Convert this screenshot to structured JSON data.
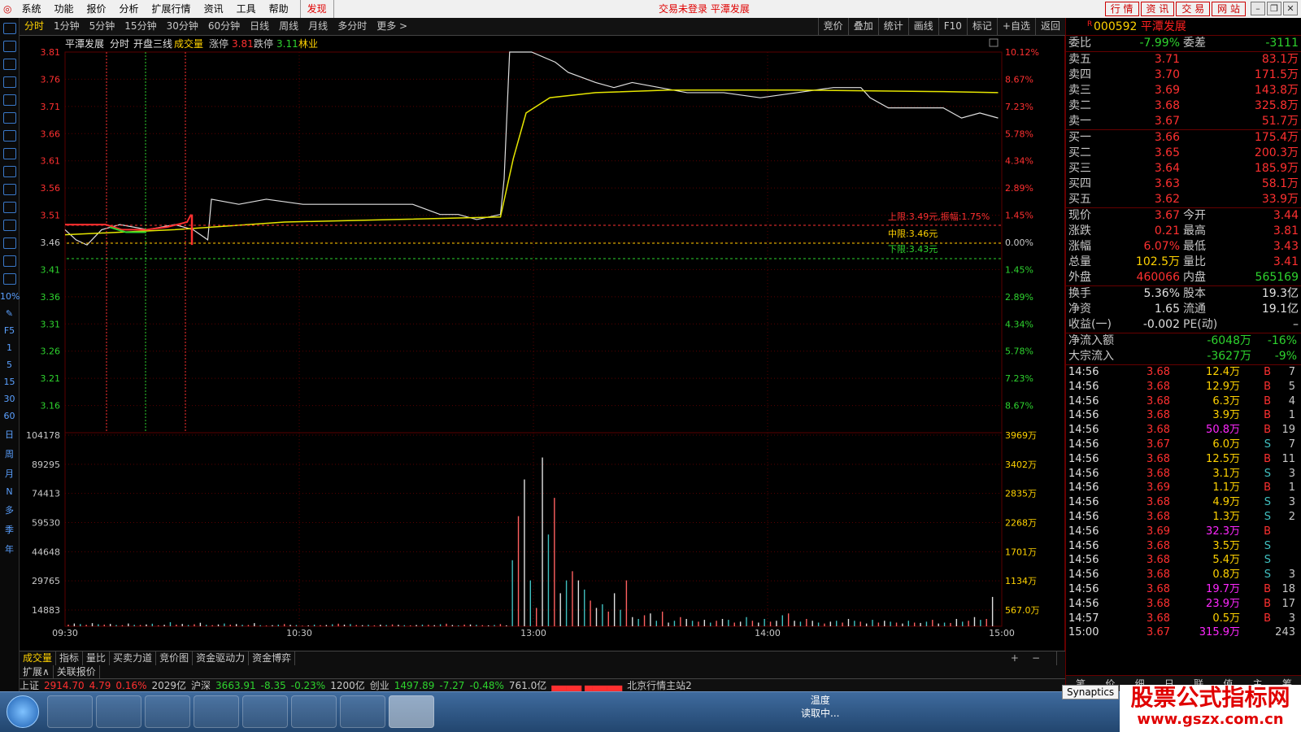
{
  "menubar": {
    "items": [
      "系统",
      "功能",
      "报价",
      "分析",
      "扩展行情",
      "资讯",
      "工具",
      "帮助"
    ],
    "highlight": "发现",
    "status": "交易未登录  平潭发展",
    "right_buttons": [
      "行  情",
      "资  讯",
      "交  易",
      "网  站"
    ]
  },
  "timeframes": {
    "items": [
      "分时",
      "1分钟",
      "5分钟",
      "15分钟",
      "30分钟",
      "60分钟",
      "日线",
      "周线",
      "月线",
      "多分时",
      "更多 >"
    ],
    "active_index": 0,
    "right_tools": [
      "竞价",
      "叠加",
      "统计",
      "画线",
      "F10",
      "标记",
      "+自选",
      "返回"
    ]
  },
  "chart_header": {
    "name": "平潭发展",
    "type": "分时",
    "overlay": "开盘三线",
    "indicator": "成交量",
    "zt_label": "涨停",
    "zt_value": "3.81",
    "dt_label": "跌停",
    "dt_value": "3.11",
    "sector": "林业"
  },
  "price_annotations": {
    "upper": "上限:3.49元,振幅:1.75%",
    "middle": "中限:3.46元",
    "lower": "下限:3.43元"
  },
  "left_toolbar_labels": [
    "10%",
    "F5",
    "1",
    "5",
    "15",
    "30",
    "60",
    "日",
    "周",
    "月",
    "N",
    "多",
    "季",
    "年"
  ],
  "chart_data": [
    {
      "type": "line",
      "title": "平潭发展 分时",
      "prev_close": 3.46,
      "ylim": [
        3.11,
        3.81
      ],
      "y_ticks": [
        "3.81",
        "3.76",
        "3.71",
        "3.66",
        "3.61",
        "3.56",
        "3.51",
        "3.46",
        "3.41",
        "3.36",
        "3.31",
        "3.26",
        "3.21",
        "3.16"
      ],
      "y_right_ticks": [
        "10.12%",
        "8.67%",
        "7.23%",
        "5.78%",
        "4.34%",
        "2.89%",
        "1.45%",
        "0.00%",
        "1.45%",
        "2.89%",
        "4.34%",
        "5.78%",
        "7.23%",
        "8.67%"
      ],
      "x_ticks": [
        "09:30",
        "10:30",
        "13:00",
        "14:00",
        "15:00"
      ],
      "series": [
        {
          "name": "价格",
          "color": "#e0e0e0",
          "points": [
            [
              0,
              3.46
            ],
            [
              6,
              3.44
            ],
            [
              12,
              3.43
            ],
            [
              20,
              3.46
            ],
            [
              30,
              3.47
            ],
            [
              45,
              3.46
            ],
            [
              60,
              3.47
            ],
            [
              70,
              3.46
            ],
            [
              78,
              3.44
            ],
            [
              80,
              3.52
            ],
            [
              95,
              3.51
            ],
            [
              110,
              3.52
            ],
            [
              130,
              3.51
            ],
            [
              150,
              3.51
            ],
            [
              170,
              3.51
            ],
            [
              190,
              3.51
            ],
            [
              205,
              3.49
            ],
            [
              215,
              3.49
            ],
            [
              225,
              3.48
            ],
            [
              238,
              3.49
            ],
            [
              240,
              3.56
            ],
            [
              243,
              3.81
            ],
            [
              255,
              3.81
            ],
            [
              268,
              3.79
            ],
            [
              275,
              3.77
            ],
            [
              290,
              3.75
            ],
            [
              300,
              3.74
            ],
            [
              310,
              3.75
            ],
            [
              325,
              3.74
            ],
            [
              340,
              3.73
            ],
            [
              360,
              3.73
            ],
            [
              380,
              3.72
            ],
            [
              400,
              3.73
            ],
            [
              420,
              3.74
            ],
            [
              435,
              3.74
            ],
            [
              440,
              3.72
            ],
            [
              450,
              3.7
            ],
            [
              460,
              3.7
            ],
            [
              470,
              3.7
            ],
            [
              480,
              3.7
            ],
            [
              485,
              3.69
            ],
            [
              490,
              3.68
            ],
            [
              500,
              3.69
            ],
            [
              510,
              3.68
            ]
          ]
        },
        {
          "name": "均价",
          "color": "#e6e600",
          "points": [
            [
              0,
              3.45
            ],
            [
              30,
              3.455
            ],
            [
              60,
              3.46
            ],
            [
              80,
              3.465
            ],
            [
              120,
              3.475
            ],
            [
              180,
              3.48
            ],
            [
              238,
              3.485
            ],
            [
              245,
              3.6
            ],
            [
              252,
              3.69
            ],
            [
              265,
              3.72
            ],
            [
              290,
              3.73
            ],
            [
              330,
              3.735
            ],
            [
              400,
              3.735
            ],
            [
              480,
              3.732
            ],
            [
              510,
              3.73
            ]
          ]
        }
      ]
    },
    {
      "type": "bar",
      "title": "成交量",
      "y_ticks": [
        "104178",
        "89295",
        "74413",
        "59530",
        "44648",
        "29765",
        "14883"
      ],
      "y_right_ticks": [
        "3969万",
        "3402万",
        "2835万",
        "2268万",
        "1701万",
        "1134万",
        "567.0万"
      ],
      "ylim": [
        0,
        104178
      ],
      "values": [
        900,
        1500,
        1200,
        800,
        1700,
        1100,
        900,
        1300,
        700,
        600,
        1500,
        800,
        700,
        1000,
        1400,
        500,
        800,
        2200,
        900,
        1300,
        700,
        1100,
        1900,
        800,
        600,
        1000,
        1500,
        900,
        1200,
        800,
        700,
        1700,
        600,
        400,
        600,
        900,
        1200,
        800,
        700,
        300,
        500,
        900,
        600,
        700,
        1100,
        1400,
        900,
        1200,
        700,
        600,
        800,
        500,
        900,
        700,
        1000,
        800,
        600,
        500,
        700,
        900,
        800,
        600,
        1100,
        1400,
        700,
        500,
        900,
        1000,
        800,
        600,
        500,
        700,
        1200,
        500,
        36000,
        60000,
        80000,
        25000,
        10000,
        92000,
        50000,
        70000,
        18000,
        25000,
        30000,
        25000,
        20000,
        14000,
        10000,
        12000,
        8000,
        18000,
        9000,
        25000,
        5000,
        4000,
        6000,
        7000,
        3000,
        8000,
        2000,
        3000,
        5000,
        4000,
        3000,
        2500,
        3500,
        2000,
        3000,
        4000,
        3500,
        2000,
        2500,
        5000,
        3000,
        2000,
        4000,
        2500,
        3000,
        6000,
        7000,
        3000,
        2500,
        4000,
        3000,
        2000,
        1500,
        2500,
        3000,
        2000,
        4000,
        3000,
        2500,
        1500,
        3500,
        2000,
        3000,
        2500,
        2000,
        1500,
        3000,
        2000,
        1800,
        2500,
        3500,
        1500,
        2000,
        1800,
        4000,
        2500,
        3000,
        5000,
        3500,
        4000,
        16000
      ]
    }
  ],
  "quote": {
    "code": "000592",
    "name": "平潭发展",
    "tag": "R",
    "weibi_label": "委比",
    "weibi": "-7.99%",
    "weicha_label": "委差",
    "weicha": "-3111",
    "sells": [
      {
        "label": "卖五",
        "price": "3.71",
        "vol": "83.1万"
      },
      {
        "label": "卖四",
        "price": "3.70",
        "vol": "171.5万"
      },
      {
        "label": "卖三",
        "price": "3.69",
        "vol": "143.8万"
      },
      {
        "label": "卖二",
        "price": "3.68",
        "vol": "325.8万"
      },
      {
        "label": "卖一",
        "price": "3.67",
        "vol": "51.7万"
      }
    ],
    "buys": [
      {
        "label": "买一",
        "price": "3.66",
        "vol": "175.4万"
      },
      {
        "label": "买二",
        "price": "3.65",
        "vol": "200.3万"
      },
      {
        "label": "买三",
        "price": "3.64",
        "vol": "185.9万"
      },
      {
        "label": "买四",
        "price": "3.63",
        "vol": "58.1万"
      },
      {
        "label": "买五",
        "price": "3.62",
        "vol": "33.9万"
      }
    ],
    "stats": [
      {
        "l1": "现价",
        "v1": "3.67",
        "l2": "今开",
        "v2": "3.44",
        "c1": "red",
        "c2": "red"
      },
      {
        "l1": "涨跌",
        "v1": "0.21",
        "l2": "最高",
        "v2": "3.81",
        "c1": "red",
        "c2": "red"
      },
      {
        "l1": "涨幅",
        "v1": "6.07%",
        "l2": "最低",
        "v2": "3.43",
        "c1": "red",
        "c2": "red"
      },
      {
        "l1": "总量",
        "v1": "102.5万",
        "l2": "量比",
        "v2": "3.41",
        "c1": "yellow",
        "c2": "red"
      },
      {
        "l1": "外盘",
        "v1": "460066",
        "l2": "内盘",
        "v2": "565169",
        "c1": "red",
        "c2": "green"
      }
    ],
    "stats2": [
      {
        "l1": "换手",
        "v1": "5.36%",
        "l2": "股本",
        "v2": "19.3亿",
        "c1": "white",
        "c2": "white"
      },
      {
        "l1": "净资",
        "v1": "1.65",
        "l2": "流通",
        "v2": "19.1亿",
        "c1": "white",
        "c2": "white"
      },
      {
        "l1": "收益(一)",
        "v1": "-0.002",
        "l2": "PE(动)",
        "v2": "–",
        "c1": "white",
        "c2": "white"
      }
    ],
    "flows": [
      {
        "label": "净流入额",
        "value": "-6048万",
        "pct": "-16%"
      },
      {
        "label": "大宗流入",
        "value": "-3627万",
        "pct": "-9%"
      }
    ]
  },
  "ticks": [
    {
      "t": "14:56",
      "p": "3.68",
      "v": "12.4万",
      "d": "B",
      "n": "7",
      "pc": "red",
      "vc": "yellow"
    },
    {
      "t": "14:56",
      "p": "3.68",
      "v": "12.9万",
      "d": "B",
      "n": "5",
      "pc": "red",
      "vc": "yellow"
    },
    {
      "t": "14:56",
      "p": "3.68",
      "v": "6.3万",
      "d": "B",
      "n": "4",
      "pc": "red",
      "vc": "yellow"
    },
    {
      "t": "14:56",
      "p": "3.68",
      "v": "3.9万",
      "d": "B",
      "n": "1",
      "pc": "red",
      "vc": "yellow"
    },
    {
      "t": "14:56",
      "p": "3.68",
      "v": "50.8万",
      "d": "B",
      "n": "19",
      "pc": "red",
      "vc": "mag"
    },
    {
      "t": "14:56",
      "p": "3.67",
      "v": "6.0万",
      "d": "S",
      "n": "7",
      "pc": "red",
      "vc": "yellow"
    },
    {
      "t": "14:56",
      "p": "3.68",
      "v": "12.5万",
      "d": "B",
      "n": "11",
      "pc": "red",
      "vc": "yellow"
    },
    {
      "t": "14:56",
      "p": "3.68",
      "v": "3.1万",
      "d": "S",
      "n": "3",
      "pc": "red",
      "vc": "yellow"
    },
    {
      "t": "14:56",
      "p": "3.69",
      "v": "1.1万",
      "d": "B",
      "n": "1",
      "pc": "red",
      "vc": "yellow"
    },
    {
      "t": "14:56",
      "p": "3.68",
      "v": "4.9万",
      "d": "S",
      "n": "3",
      "pc": "red",
      "vc": "yellow"
    },
    {
      "t": "14:56",
      "p": "3.68",
      "v": "1.3万",
      "d": "S",
      "n": "2",
      "pc": "red",
      "vc": "yellow"
    },
    {
      "t": "14:56",
      "p": "3.69",
      "v": "32.3万",
      "d": "B",
      "n": "",
      "pc": "red",
      "vc": "mag"
    },
    {
      "t": "14:56",
      "p": "3.68",
      "v": "3.5万",
      "d": "S",
      "n": "",
      "pc": "red",
      "vc": "yellow"
    },
    {
      "t": "14:56",
      "p": "3.68",
      "v": "5.4万",
      "d": "S",
      "n": "",
      "pc": "red",
      "vc": "yellow"
    },
    {
      "t": "14:56",
      "p": "3.68",
      "v": "0.8万",
      "d": "S",
      "n": "3",
      "pc": "red",
      "vc": "yellow"
    },
    {
      "t": "14:56",
      "p": "3.68",
      "v": "19.7万",
      "d": "B",
      "n": "18",
      "pc": "red",
      "vc": "mag"
    },
    {
      "t": "14:56",
      "p": "3.68",
      "v": "23.9万",
      "d": "B",
      "n": "17",
      "pc": "red",
      "vc": "mag"
    },
    {
      "t": "14:57",
      "p": "3.68",
      "v": "0.5万",
      "d": "B",
      "n": "3",
      "pc": "red",
      "vc": "yellow"
    },
    {
      "t": "15:00",
      "p": "3.67",
      "v": "315.9万",
      "d": "",
      "n": "243",
      "pc": "red",
      "vc": "mag"
    }
  ],
  "rp_tabs": [
    "笔",
    "价",
    "细",
    "日",
    "联",
    "值",
    "主",
    "筹"
  ],
  "bottom_tabs": [
    "成交量",
    "指标",
    "量比",
    "买卖力道",
    "竞价图",
    "资金驱动力",
    "资金博弈"
  ],
  "ext_tabs": [
    "扩展∧",
    "关联报价"
  ],
  "status": {
    "sh_label": "上证",
    "sh_val": "2914.70",
    "sh_chg": "4.79",
    "sh_pct": "0.16%",
    "sh_amt": "2029亿",
    "sz_label": "沪深",
    "sz_val": "3663.91",
    "sz_chg": "-8.35",
    "sz_pct": "-0.23%",
    "sz_amt": "1200亿",
    "cy_label": "创业",
    "cy_val": "1497.89",
    "cy_chg": "-7.27",
    "cy_pct": "-0.48%",
    "cy_amt": "761.0亿",
    "server": "北京行情主站2"
  },
  "taskbar": {
    "tray_line1": "温度",
    "tray_line2": "读取中..."
  },
  "synaptics": "Synaptics",
  "brand": {
    "line1": "股票公式指标网",
    "line2": "www.gszx.com.cn"
  },
  "colors": {
    "up": "#ff3030",
    "down": "#2ed32e",
    "avg": "#e6e600",
    "price": "#e0e0e0",
    "grid": "#5a0000"
  }
}
